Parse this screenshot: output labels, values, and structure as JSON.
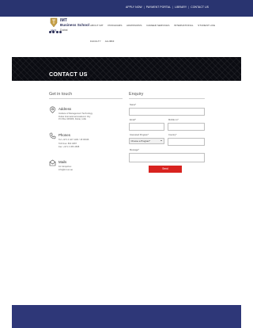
{
  "topbar": {
    "links": [
      "APPLY NOW",
      "PAYMENT PORTAL",
      "LIBRARY",
      "CONTACT US"
    ]
  },
  "logo": {
    "name": "IMT",
    "line2": "Business School",
    "city": "Dubai",
    "year": "2007"
  },
  "nav": {
    "items": [
      "ABOUT IMT",
      "PROGRAMS",
      "ADMISSIONS",
      "CAREER SERVICES",
      "INTERNATIONAL",
      "STUDENT LIFE"
    ],
    "items_row2": [
      "FACULTY",
      "ALUMNI"
    ]
  },
  "hero": {
    "title": "CONTACT US"
  },
  "get_in_touch": {
    "heading": "Get in touch",
    "address": {
      "label": "Address",
      "lines": [
        "Institute of Management Technology",
        "Dubai International Academic City",
        "P.O.Box 345006, Dubai, UAE"
      ]
    },
    "phones": {
      "label": "Phones",
      "lines": [
        "Tel: +971 4 427 1100 / 18 00046",
        "Toll Free: 800 4687",
        "Fax: +971 4 366 4698"
      ]
    },
    "mails": {
      "label": "Mails",
      "lines": [
        "For Enquiries:",
        "info@imt.ac.ae"
      ]
    }
  },
  "enquiry": {
    "heading": "Enquiry",
    "name_label": "Name*",
    "email_label": "Email*",
    "mobile_label": "Mobile no*",
    "program_label": "Interested Program*",
    "program_value": "Choose a Program*",
    "country_label": "Country*",
    "message_label": "Message*",
    "send_label": "Send"
  },
  "colors": {
    "topbar": "#293470",
    "hero": "#0b0c12",
    "send": "#d8231f",
    "footer": "#2e3778"
  }
}
